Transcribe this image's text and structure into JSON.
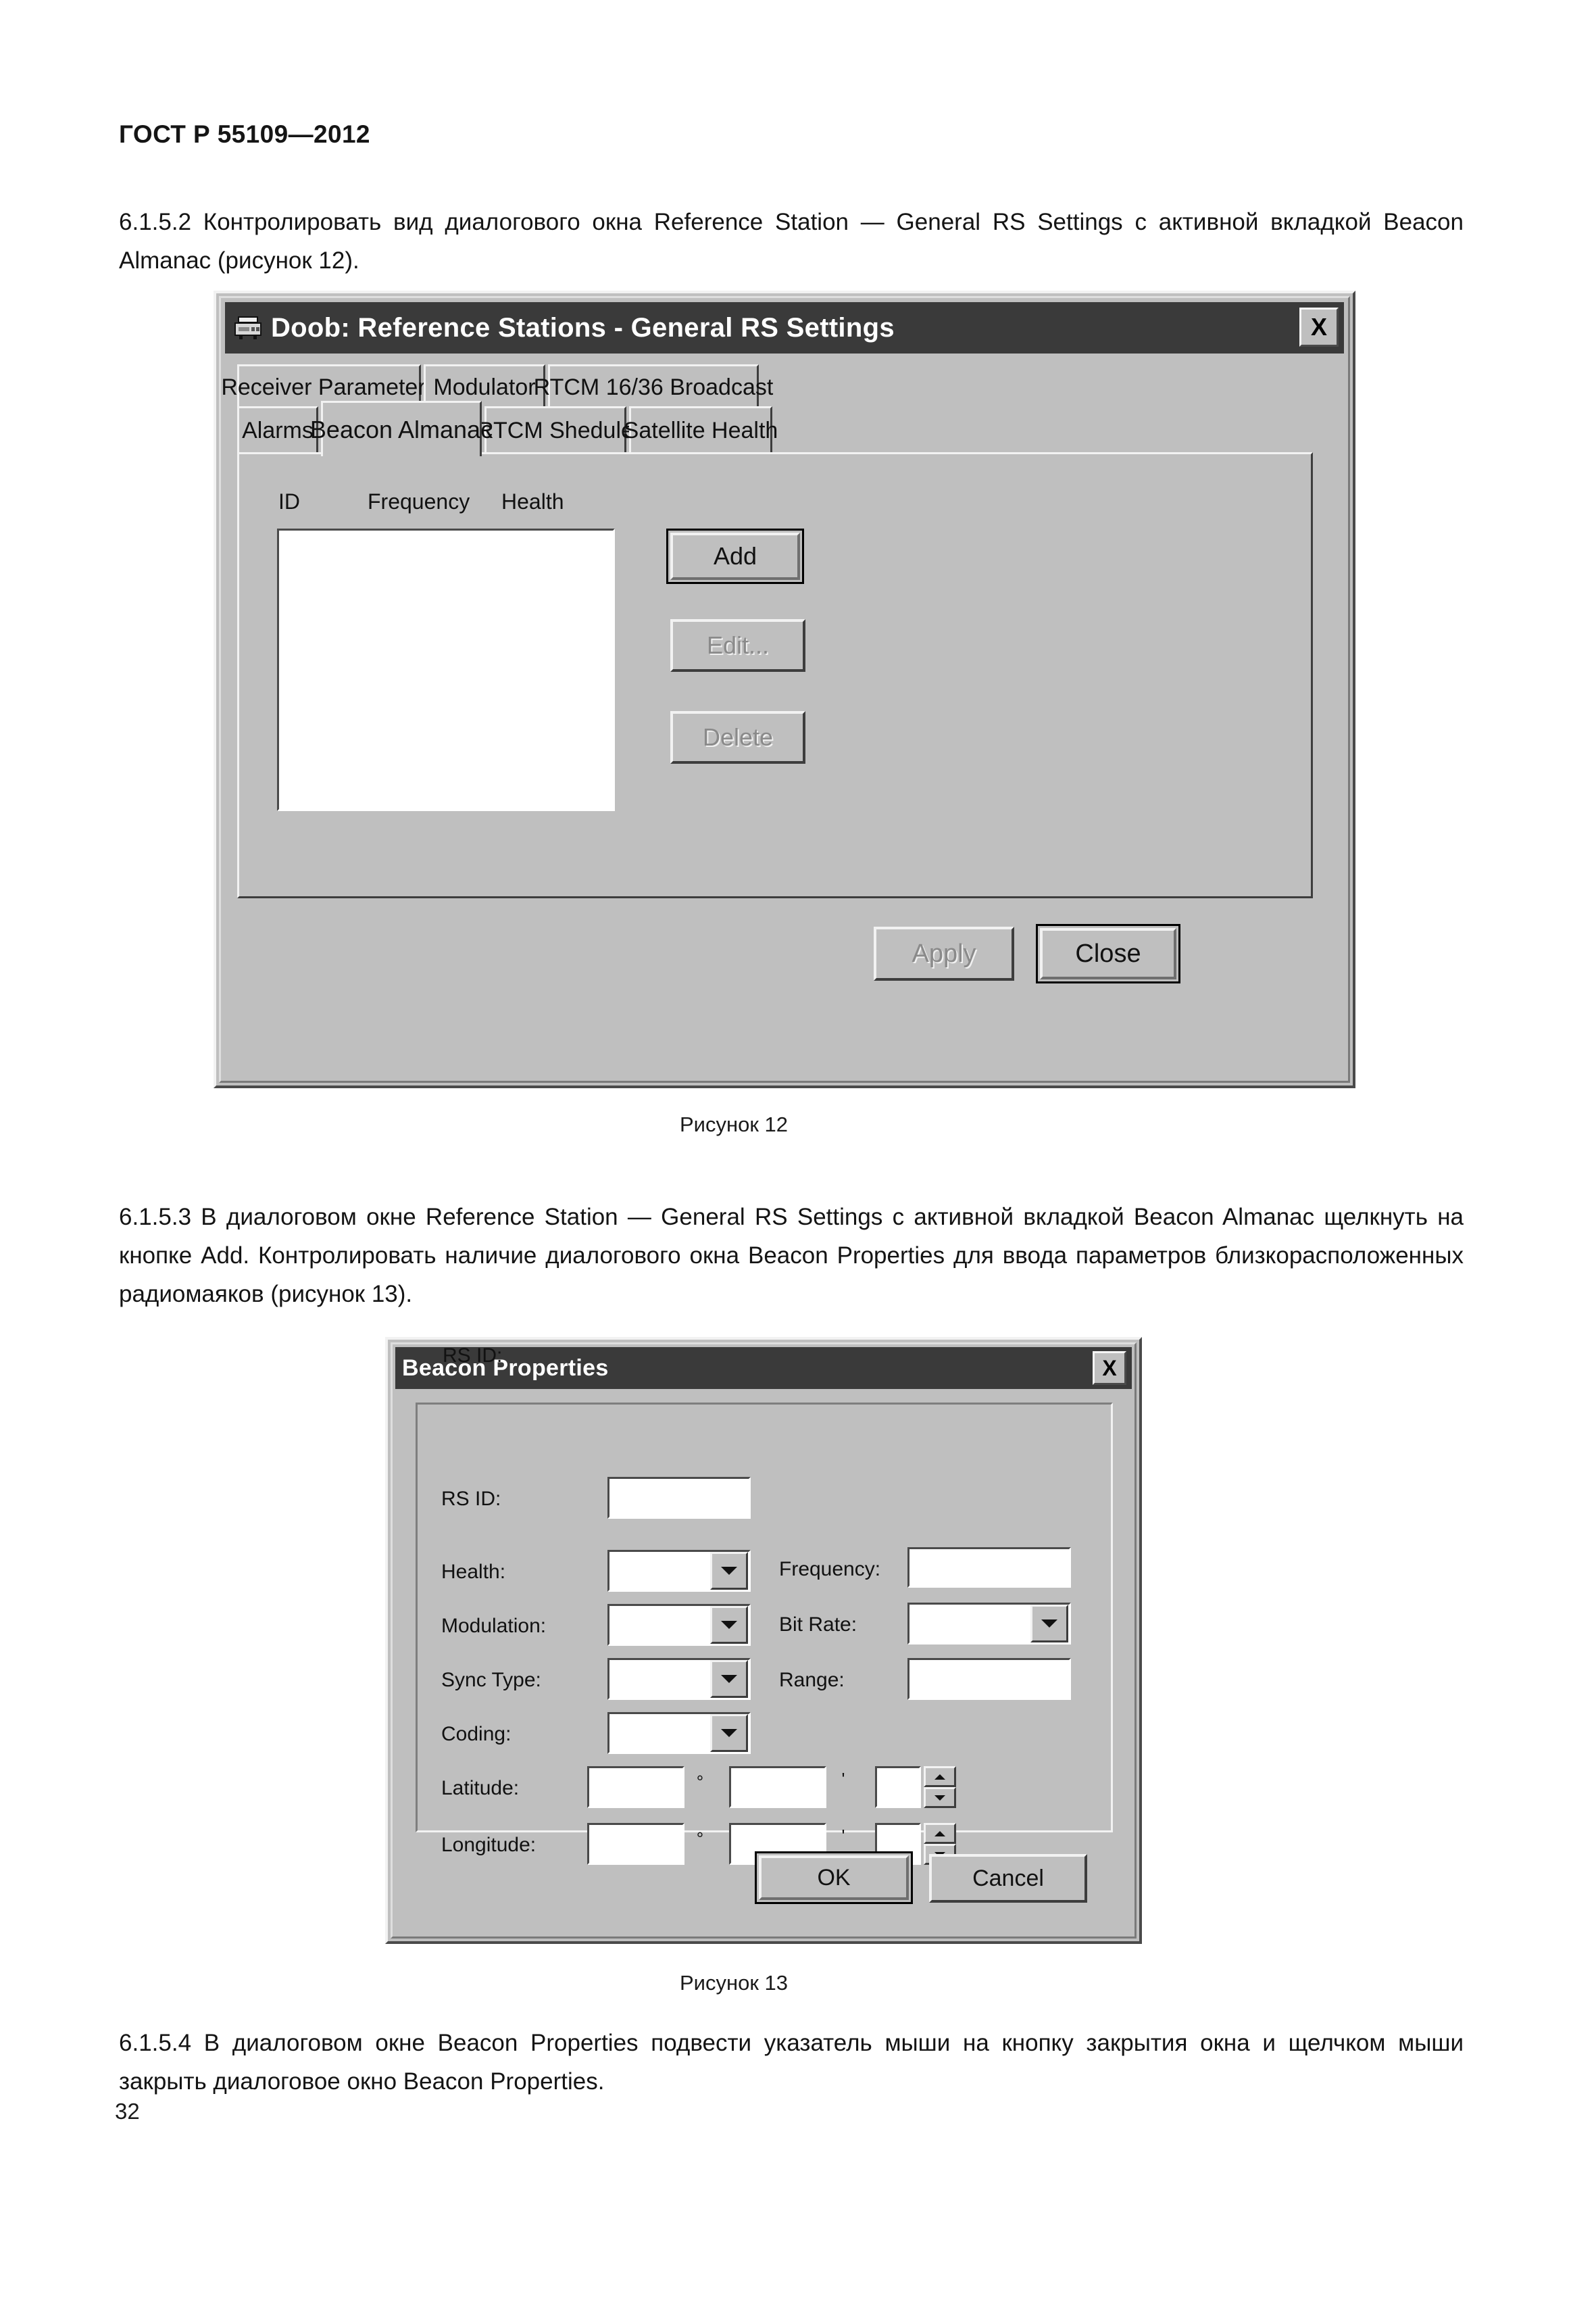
{
  "document": {
    "standard_header": "ГОСТ Р 55109—2012",
    "page_number": "32",
    "paragraphs": [
      {
        "id": "6.1.5.2",
        "text": "6.1.5.2 Контролировать вид диалогового окна Reference Station — General RS Settings с активной вкладкой Beacon Almanac (рисунок 12)."
      },
      {
        "id": "6.1.5.3",
        "text": "6.1.5.3 В диалоговом окне Reference Station — General RS Settings с активной вкладкой Beacon Almanac щелкнуть на кнопке Add. Контролировать наличие диалогового окна Beacon Properties для ввода параметров близкорасположенных радиомаяков (рисунок 13)."
      },
      {
        "id": "6.1.5.4",
        "text": "6.1.5.4 В диалоговом окне Beacon Properties подвести указатель мыши на кнопку закрытия окна и щелчком мыши закрыть диалоговое окно Beacon Properties."
      }
    ],
    "figure_captions": {
      "figure_12": "Рисунок 12",
      "figure_13": "Рисунок 13"
    }
  },
  "figure12": {
    "window": {
      "title": "Doob: Reference Stations - General RS Settings",
      "icon": "device-icon",
      "close_label": "X"
    },
    "tabs_row1": [
      {
        "label": "Receiver Parameters",
        "active": false
      },
      {
        "label": "Modulator",
        "active": false
      },
      {
        "label": "RTCM 16/36 Broadcast",
        "active": false
      }
    ],
    "tabs_row2": [
      {
        "label": "Alarms",
        "active": false
      },
      {
        "label": "Beacon Almanac",
        "active": true
      },
      {
        "label": "RTCM Shedule",
        "active": false
      },
      {
        "label": "Satellite Health",
        "active": false
      }
    ],
    "list": {
      "columns": [
        "ID",
        "Frequency",
        "Health"
      ],
      "rows": []
    },
    "side_buttons": [
      {
        "label": "Add",
        "state": "default"
      },
      {
        "label": "Edit...",
        "state": "disabled"
      },
      {
        "label": "Delete",
        "state": "disabled"
      }
    ],
    "footer_buttons": [
      {
        "label": "Apply",
        "state": "disabled"
      },
      {
        "label": "Close",
        "state": "default"
      }
    ]
  },
  "figure13": {
    "window": {
      "title": "Beacon Properties",
      "close_label": "X"
    },
    "fields_left": [
      {
        "label": "RS ID:",
        "type": "text",
        "value": ""
      },
      {
        "label": "Health:",
        "type": "combo",
        "value": ""
      },
      {
        "label": "Modulation:",
        "type": "combo",
        "value": ""
      },
      {
        "label": "Sync Type:",
        "type": "combo",
        "value": ""
      },
      {
        "label": "Coding:",
        "type": "combo",
        "value": ""
      }
    ],
    "fields_right": [
      {
        "label": "Frequency:",
        "type": "text",
        "value": ""
      },
      {
        "label": "Bit Rate:",
        "type": "combo",
        "value": ""
      },
      {
        "label": "Range:",
        "type": "text",
        "value": ""
      }
    ],
    "coord_rows": [
      {
        "label": "Latitude:",
        "deg": "",
        "min": "",
        "sec": "",
        "deg_symbol": "°",
        "min_symbol": "'"
      },
      {
        "label": "Longitude:",
        "deg": "",
        "min": "",
        "sec": "",
        "deg_symbol": "°",
        "min_symbol": "'"
      }
    ],
    "footer_buttons": [
      {
        "label": "OK",
        "state": "default"
      },
      {
        "label": "Cancel",
        "state": "normal"
      }
    ]
  },
  "colors": {
    "dialog_face": "#bfbfbf",
    "titlebar": "#3a3a3a",
    "titlebar_text": "#ffffff",
    "field_bg": "#ffffff",
    "text": "#111111",
    "disabled_text": "#8a8a8a",
    "page_bg": "#ffffff"
  }
}
